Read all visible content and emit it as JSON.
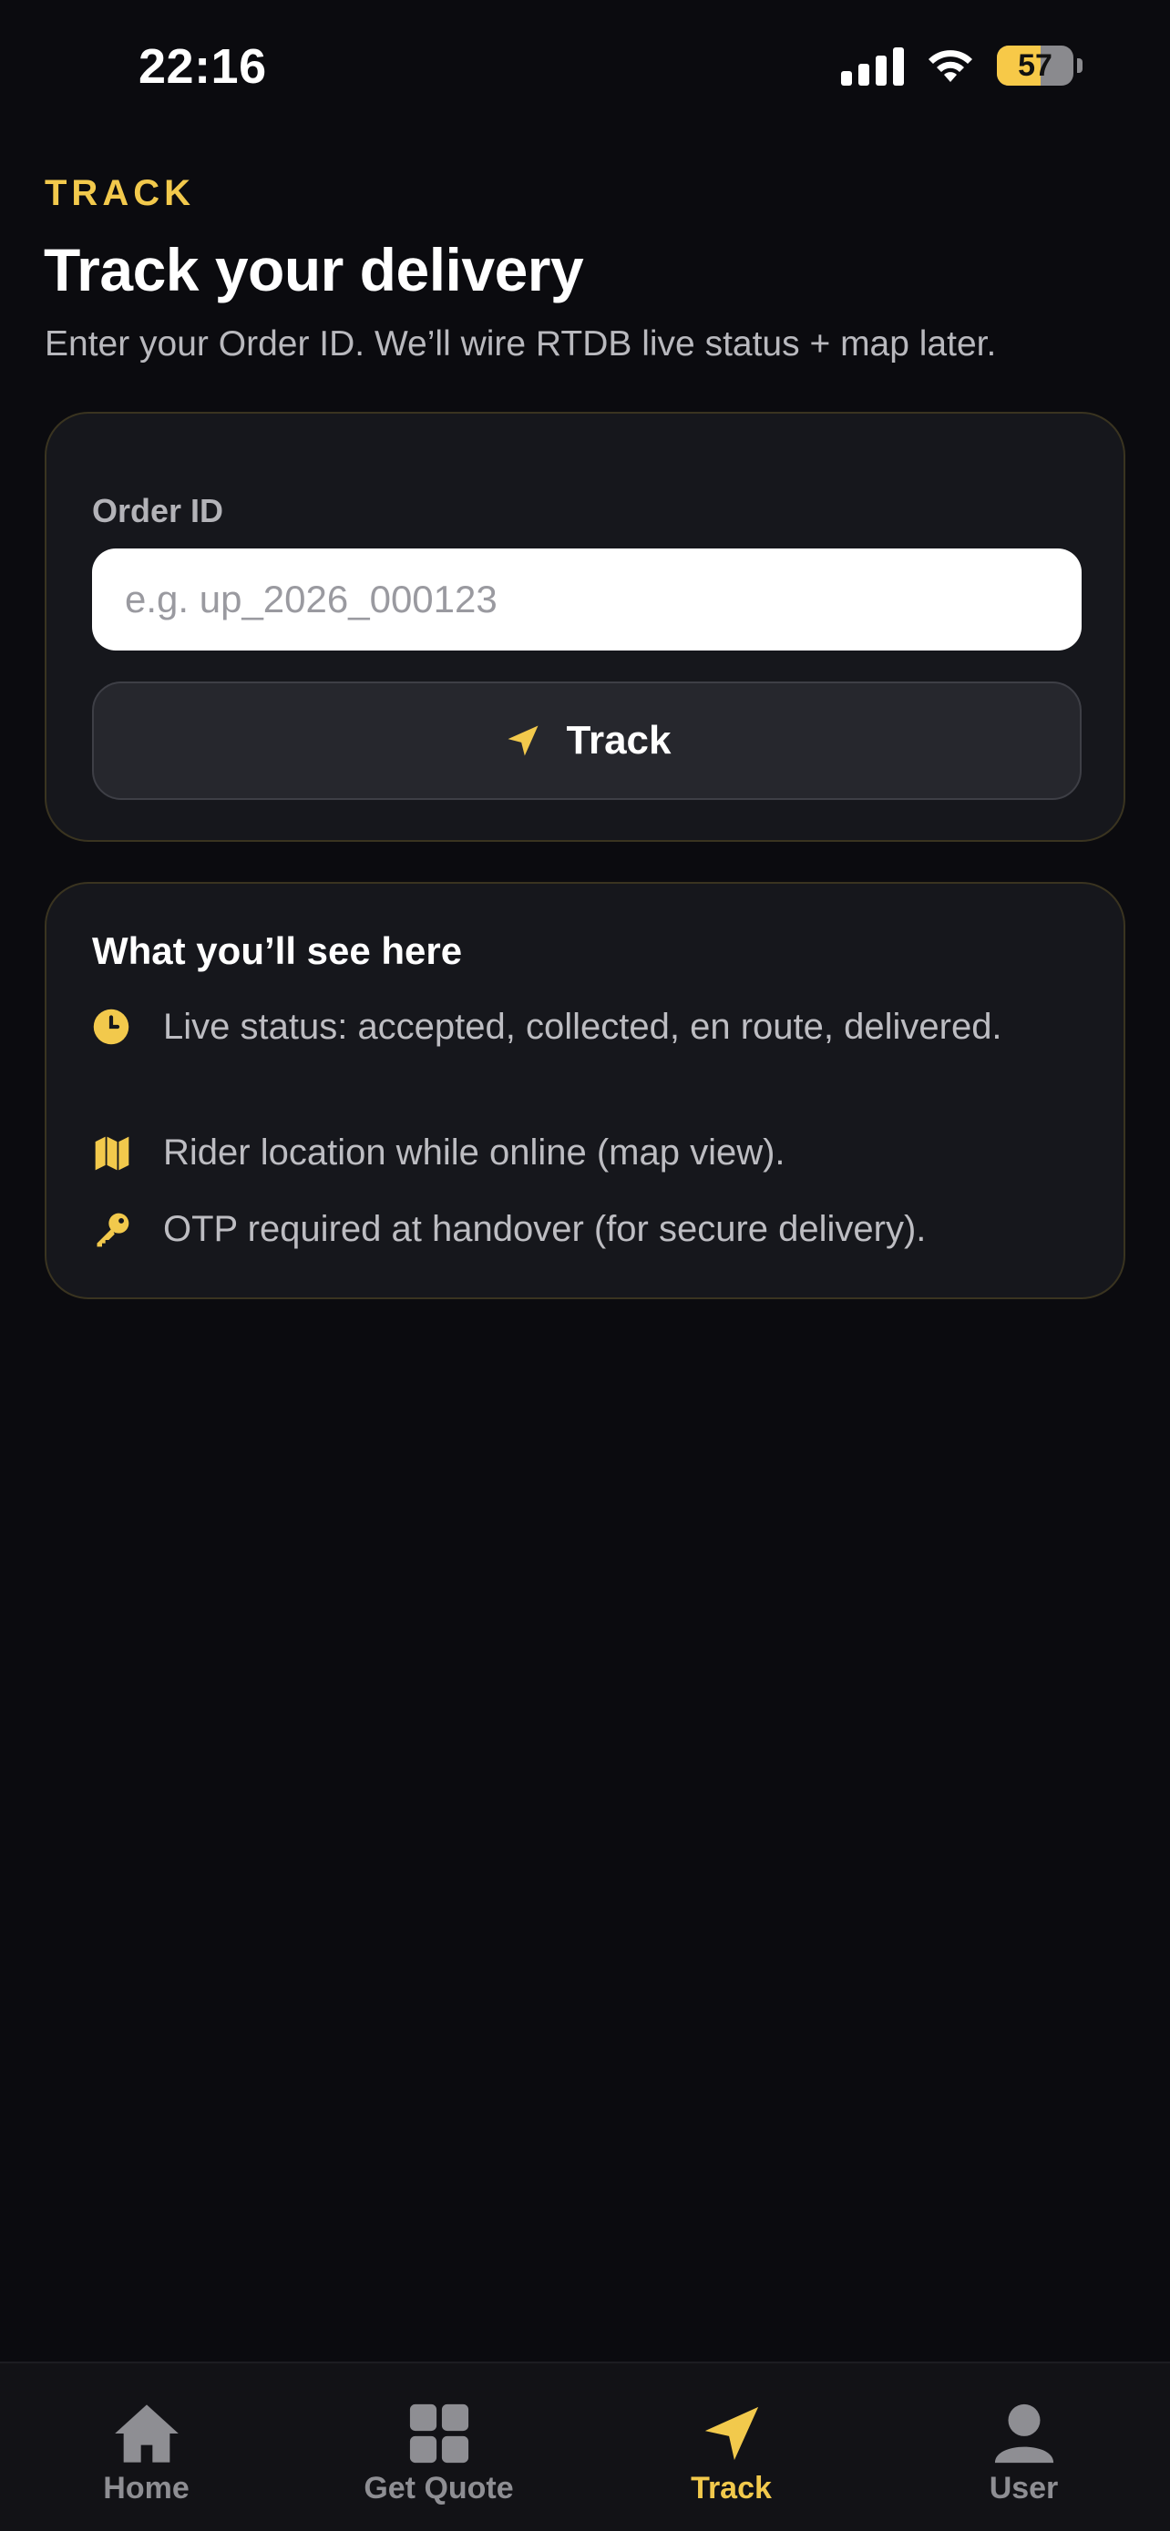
{
  "status_bar": {
    "time": "22:16",
    "battery": "57",
    "battery_level": 0.57
  },
  "header": {
    "eyebrow": "TRACK",
    "title": "Track your delivery",
    "subtitle": "Enter your Order ID. We’ll wire RTDB live status + map later."
  },
  "form": {
    "label": "Order ID",
    "input_value": "",
    "placeholder": "e.g. up_2026_000123",
    "button_label": "Track"
  },
  "info": {
    "title": "What you’ll see here",
    "items": [
      {
        "icon": "clock-icon",
        "text": "Live status: accepted, collected, en route, delivered."
      },
      {
        "icon": "map-icon",
        "text": "Rider location while online (map view)."
      },
      {
        "icon": "key-icon",
        "text": "OTP required at handover (for secure delivery)."
      }
    ]
  },
  "tabs": [
    {
      "label": "Home",
      "icon": "home-icon",
      "active": false
    },
    {
      "label": "Get Quote",
      "icon": "grid-icon",
      "active": false
    },
    {
      "label": "Track",
      "icon": "navigation-arrow-icon",
      "active": true
    },
    {
      "label": "User",
      "icon": "user-icon",
      "active": false
    }
  ],
  "colors": {
    "accent": "#f2c94c",
    "background": "#0b0b0f",
    "card": "#16171c",
    "inactive": "#8e8e93"
  }
}
